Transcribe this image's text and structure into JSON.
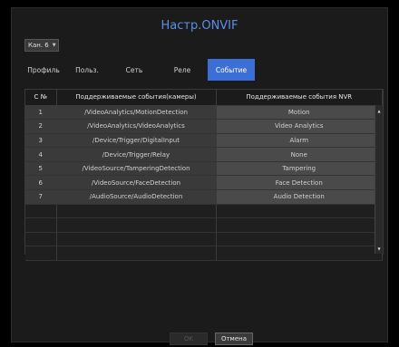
{
  "title": "Настр.ONVIF",
  "channel": {
    "value": "Кан. 6"
  },
  "tabs": [
    {
      "label": "Профиль",
      "active": false
    },
    {
      "label": "Польз.",
      "active": false
    },
    {
      "label": "Сеть",
      "active": false
    },
    {
      "label": "Реле",
      "active": false
    },
    {
      "label": "Событие",
      "active": true
    }
  ],
  "table": {
    "headers": [
      "С №",
      "Поддерживаемые события(камеры)",
      "Поддерживаемые события NVR"
    ],
    "rows": [
      {
        "no": "1",
        "camera_event": "/VideoAnalytics/MotionDetection",
        "nvr_event": "Motion"
      },
      {
        "no": "2",
        "camera_event": "/VideoAnalytics/VideoAnalytics",
        "nvr_event": "Video Analytics"
      },
      {
        "no": "3",
        "camera_event": "/Device/Trigger/DigitalInput",
        "nvr_event": "Alarm"
      },
      {
        "no": "4",
        "camera_event": "/Device/Trigger/Relay",
        "nvr_event": "None"
      },
      {
        "no": "5",
        "camera_event": "/VideoSource/TamperingDetection",
        "nvr_event": "Tampering"
      },
      {
        "no": "6",
        "camera_event": "/VideoSource/FaceDetection",
        "nvr_event": "Face Detection"
      },
      {
        "no": "7",
        "camera_event": "/AudioSource/AudioDetection",
        "nvr_event": "Audio Detection"
      }
    ]
  },
  "buttons": {
    "ok": "OK",
    "cancel": "Отмена"
  },
  "colors": {
    "accent": "#3b6fd6",
    "title": "#5b8fe6"
  }
}
